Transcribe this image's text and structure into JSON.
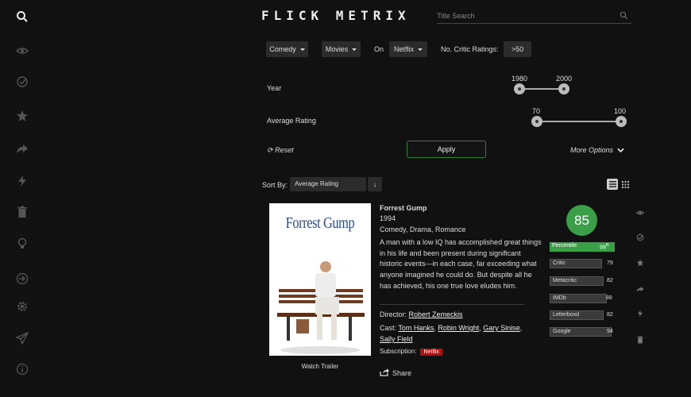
{
  "app": {
    "logo": "FLICK METRIX"
  },
  "search": {
    "placeholder": "Title Search"
  },
  "sidebar": {
    "icons": [
      "search-icon",
      "eye-icon",
      "check-circle-icon",
      "star-icon",
      "share-arrow-icon",
      "bolt-icon",
      "trash-icon",
      "bulb-icon",
      "signin-icon",
      "gear-icon",
      "paper-plane-icon",
      "info-icon"
    ]
  },
  "filters": {
    "genre": "Comedy",
    "type": "Movies",
    "on_label": "On",
    "service": "Netflix",
    "critic_label": "No. Critic Ratings:",
    "critic_value": ">50",
    "year_label": "Year",
    "year_min": "1980",
    "year_max": "2000",
    "rating_label": "Average Rating",
    "rating_min": "70",
    "rating_max": "100",
    "reset": "Reset",
    "apply": "Apply",
    "more": "More Options"
  },
  "sort": {
    "label": "Sort By:",
    "value": "Average Rating",
    "dir": "↓"
  },
  "movie": {
    "poster_title": "Forrest Gump",
    "title": "Forrest Gump",
    "year": "1994",
    "genres": "Comedy, Drama, Romance",
    "description": "A man with a low IQ has accomplished great things in his life and been present during significant historic events—in each case, far exceeding what anyone imagined he could do. But despite all he has achieved, his one true love eludes him.",
    "director_label": "Director:",
    "director": "Robert Zemeckis",
    "cast_label": "Cast:",
    "cast_1": "Tom Hanks",
    "cast_2": "Robin Wright",
    "cast_3": "Gary Sinise",
    "cast_4": "Sally Field",
    "subscription_label": "Subscription:",
    "subscription": "Netflix",
    "watch_trailer": "Watch Trailer",
    "share": "Share",
    "score": "85"
  },
  "ratings": [
    {
      "name": "Percentile",
      "value": "99",
      "sup": "th",
      "fill": 0.99
    },
    {
      "name": "Critic",
      "value": "79",
      "fill": 0.79
    },
    {
      "name": "Metacritic",
      "value": "82",
      "fill": 0.82
    },
    {
      "name": "IMDb",
      "value": "88",
      "fill": 0.88
    },
    {
      "name": "Letterboxd",
      "value": "82",
      "fill": 0.82
    },
    {
      "name": "Google",
      "value": "94",
      "fill": 0.94
    }
  ],
  "colors": {
    "accent_green": "#3aa047",
    "netflix_red": "#b40e0e",
    "poster_blue": "#2c4d86"
  }
}
